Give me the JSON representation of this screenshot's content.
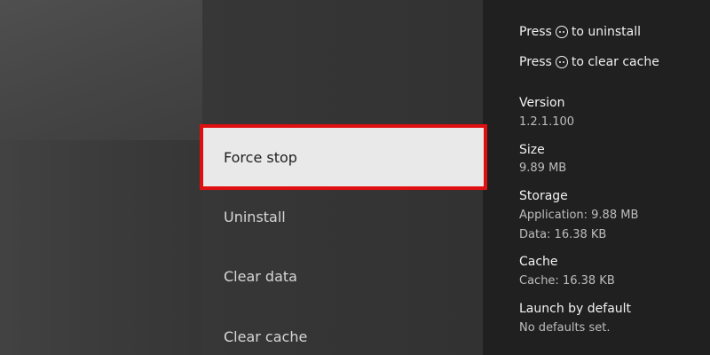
{
  "menu": {
    "focused": "Force stop",
    "items": [
      "Force stop",
      "Uninstall",
      "Clear data",
      "Clear cache"
    ]
  },
  "hints": {
    "uninstall": {
      "prefix": "Press",
      "button_icon": "menu-button-icon",
      "suffix": "to uninstall"
    },
    "clear_cache": {
      "prefix": "Press",
      "button_icon": "menu-button-icon",
      "suffix": "to clear cache"
    }
  },
  "info": {
    "version": {
      "heading": "Version",
      "value": "1.2.1.100"
    },
    "size": {
      "heading": "Size",
      "value": "9.89 MB"
    },
    "storage": {
      "heading": "Storage",
      "application": "Application: 9.88 MB",
      "data": "Data: 16.38 KB"
    },
    "cache": {
      "heading": "Cache",
      "value": "Cache: 16.38 KB"
    },
    "launch_by_default": {
      "heading": "Launch by default",
      "value": "No defaults set."
    }
  },
  "colors": {
    "focus_border": "#e01010",
    "focus_background": "#e9e9e9",
    "right_panel": "#202020"
  }
}
